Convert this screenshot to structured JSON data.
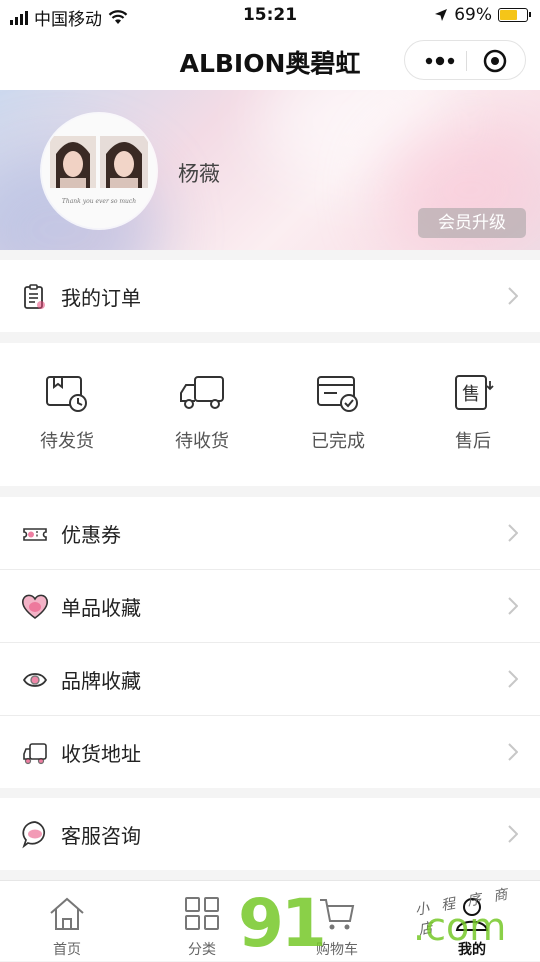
{
  "status_bar": {
    "carrier": "中国移动",
    "time": "15:21",
    "battery_percent": "69%",
    "battery_level": 0.69,
    "icons": [
      "signal-icon",
      "wifi-icon",
      "location-arrow-icon",
      "battery-icon"
    ]
  },
  "nav": {
    "title": "ALBION奥碧虹",
    "icons": [
      "more-dots-icon",
      "close-circle-icon"
    ]
  },
  "profile": {
    "username": "杨薇",
    "upgrade_label": "会员升级",
    "avatar_caption": "Thank you ever so much"
  },
  "order_row": {
    "label": "我的订单",
    "icon": "order-list-icon"
  },
  "order_status": [
    {
      "label": "待发货",
      "icon": "awaiting-shipment-icon"
    },
    {
      "label": "待收货",
      "icon": "truck-icon"
    },
    {
      "label": "已完成",
      "icon": "completed-card-icon"
    },
    {
      "label": "售后",
      "icon": "after-sales-icon"
    }
  ],
  "menu": [
    {
      "label": "优惠券",
      "icon": "coupon-icon"
    },
    {
      "label": "单品收藏",
      "icon": "heart-icon"
    },
    {
      "label": "品牌收藏",
      "icon": "eye-icon"
    },
    {
      "label": "收货地址",
      "icon": "delivery-van-icon"
    }
  ],
  "support": {
    "label": "客服咨询",
    "icon": "chat-bubble-icon"
  },
  "tabbar": [
    {
      "label": "首页",
      "icon": "home-icon",
      "active": false
    },
    {
      "label": "分类",
      "icon": "category-grid-icon",
      "active": false
    },
    {
      "label": "购物车",
      "icon": "cart-icon",
      "active": false
    },
    {
      "label": "我的",
      "icon": "user-icon",
      "active": true
    }
  ],
  "watermark": {
    "main": "91",
    "suffix": ".com",
    "small": "小 程 序 商 店"
  },
  "colors": {
    "accent_pink": "#e8487a",
    "battery_yellow": "#f5c518",
    "watermark_green": "#76c828"
  }
}
